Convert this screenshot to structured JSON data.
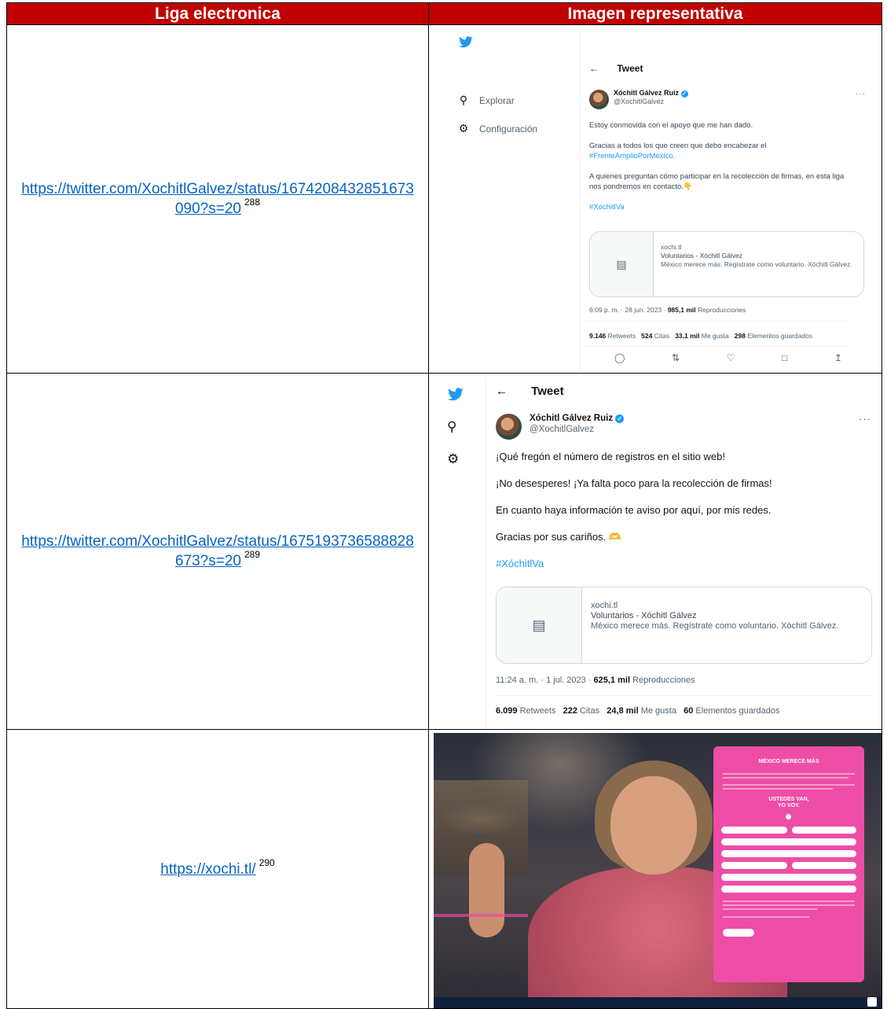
{
  "headers": {
    "col1": "Liga electronica",
    "col2": "Imagen representativa"
  },
  "rows": [
    {
      "url": "https://twitter.com/XochitlGalvez/status/1674208432851673090?s=20",
      "footnote": "288"
    },
    {
      "url": "https://twitter.com/XochitlGalvez/status/1675193736588828673?s=20",
      "footnote": "289"
    },
    {
      "url": "https://xochi.tl/",
      "footnote": "290"
    }
  ],
  "tweet1": {
    "sidebar": {
      "explore": "Explorar",
      "settings": "Configuración"
    },
    "back_title": "Tweet",
    "author": "Xóchitl Gálvez Ruiz",
    "handle": "@XochitlGalvez",
    "para1": "Estoy conmovida con el apoyo que me han dado.",
    "para2": "Gracias a todos los que creen que debo encabezar el",
    "para2_tag": "#FrenteAmplioPorMéxico.",
    "para3": "A quienes preguntan cómo participar en la recolección de firmas, en esta liga nos pondremos en contacto.👇",
    "hashtag": "#XóchitlVa",
    "card": {
      "domain": "xochi.tl",
      "title": "Voluntarios - Xóchitl Gálvez",
      "desc": "México merece más. Regístrate como voluntario. Xóchitl Gálvez."
    },
    "meta_time": "6:09 p. m. · 28 jun. 2023 · ",
    "meta_views": "985,1 mil",
    "meta_views_label": " Reproducciones",
    "stats": {
      "retweets": "9.146",
      "retweets_label": " Retweets",
      "quotes": "524",
      "quotes_label": " Citas",
      "likes": "33,1 mil",
      "likes_label": " Me gusta",
      "saves": "298",
      "saves_label": " Elementos guardados"
    }
  },
  "tweet2": {
    "back_title": "Tweet",
    "author": "Xóchitl Gálvez Ruiz",
    "handle": "@XochitlGalvez",
    "line1": "¡Qué fregón el número de registros en el sitio web!",
    "line2": "¡No desesperes! ¡Ya falta poco para la recolección de firmas!",
    "line3": "En cuanto haya información te aviso por aquí, por mis redes.",
    "line4": "Gracias por sus cariños. 🫶",
    "hashtag": "#XóchitlVa",
    "card": {
      "domain": "xochi.tl",
      "title": "Voluntarios - Xóchitl Gálvez",
      "desc": "México merece más. Regístrate como voluntario. Xóchitl Gálvez."
    },
    "meta_time": "11:24 a. m. · 1 jul. 2023 · ",
    "meta_views": "625,1 mil",
    "meta_views_label": " Reproducciones",
    "stats": {
      "retweets": "6.099",
      "retweets_label": " Retweets",
      "quotes": "222",
      "quotes_label": " Citas",
      "likes": "24,8 mil",
      "likes_label": " Me gusta",
      "saves": "60",
      "saves_label": " Elementos guardados"
    }
  },
  "site": {
    "form_title": "MÉXICO MERECE MÁS",
    "slogan1": "USTEDES VAN,",
    "slogan2": "YO VOY."
  },
  "colors": {
    "header_bg": "#c00000",
    "link": "#0563c1",
    "twitter_blue": "#1d9bf0",
    "form_pink": "#ee4da6"
  }
}
